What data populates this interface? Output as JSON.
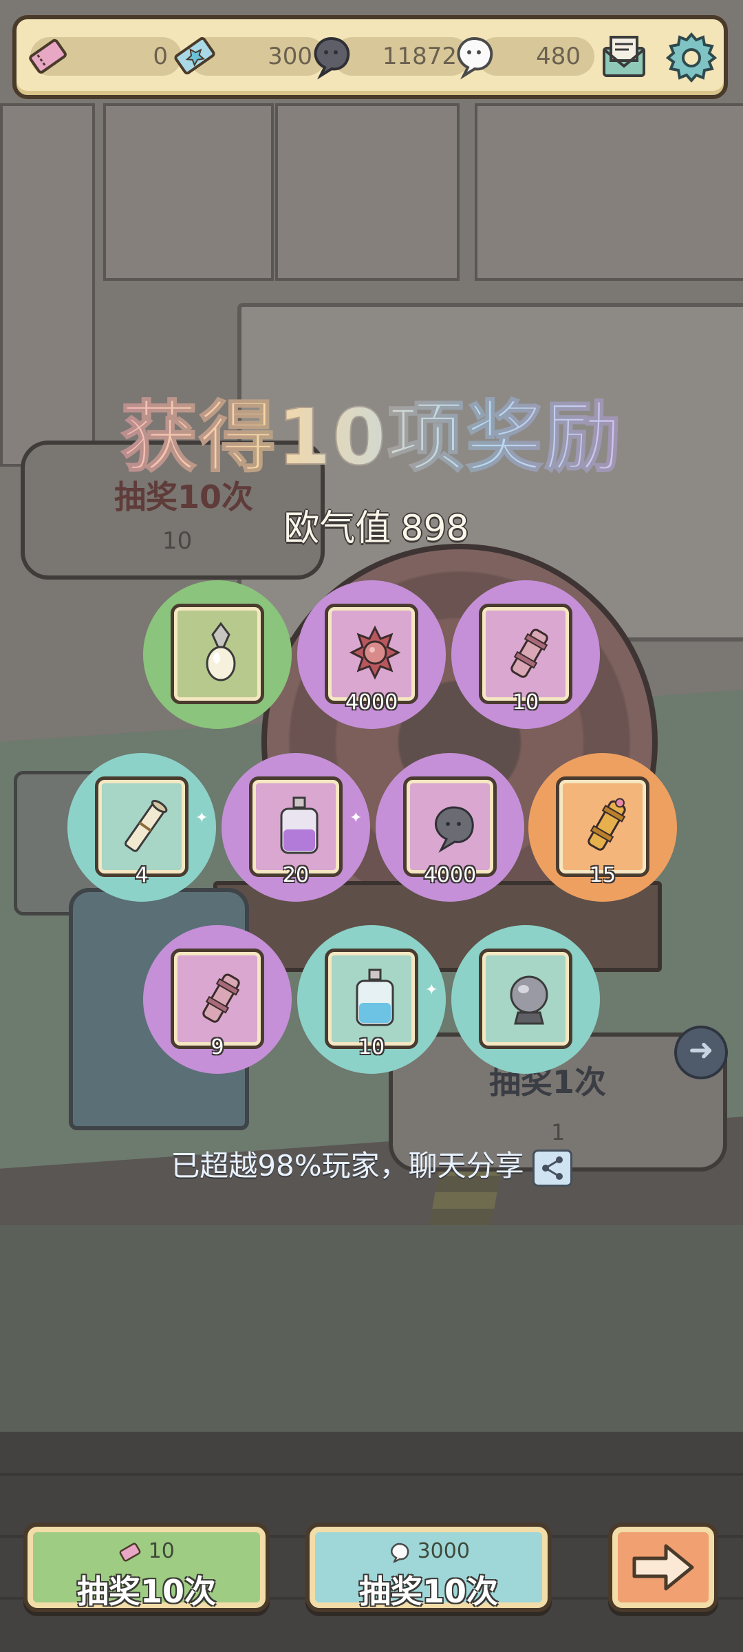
{
  "topbar": {
    "ticket_count": "0",
    "gem_count": "300",
    "dark_ghost_count": "11872",
    "white_ghost_count": "480"
  },
  "background": {
    "left_bubble_title": "抽奖10次",
    "left_bubble_cost": "10",
    "right_bubble_title": "抽奖1次",
    "right_bubble_cost": "1"
  },
  "overlay": {
    "title": "获得10项奖励",
    "luck_label": "欧气值",
    "luck_value": "898",
    "share_text": "已超越98%玩家，聊天分享"
  },
  "rewards": [
    {
      "icon": "pendant-icon",
      "qty": "",
      "color": "green"
    },
    {
      "icon": "spiky-orb-icon",
      "qty": "4000",
      "color": "purple"
    },
    {
      "icon": "cannon-scroll-icon",
      "qty": "10",
      "color": "purple"
    },
    {
      "icon": "rolled-scroll-icon",
      "qty": "4",
      "color": "teal"
    },
    {
      "icon": "purple-potion-icon",
      "qty": "20",
      "color": "purple"
    },
    {
      "icon": "grey-ghost-icon",
      "qty": "4000",
      "color": "purple"
    },
    {
      "icon": "golden-cannon-icon",
      "qty": "15",
      "color": "orange"
    },
    {
      "icon": "cannon-scroll-icon",
      "qty": "9",
      "color": "purple"
    },
    {
      "icon": "blue-potion-icon",
      "qty": "10",
      "color": "teal"
    },
    {
      "icon": "crystal-ball-icon",
      "qty": "",
      "color": "teal"
    }
  ],
  "buttons": {
    "draw_ticket_cost": "10",
    "draw_ticket_label": "抽奖10次",
    "draw_ghost_cost": "3000",
    "draw_ghost_label": "抽奖10次",
    "next_icon": "arrow-right-icon"
  },
  "colors": {
    "green": "#8bc47c",
    "purple": "#c590d7",
    "teal": "#8dd2c8",
    "orange": "#eea061"
  }
}
